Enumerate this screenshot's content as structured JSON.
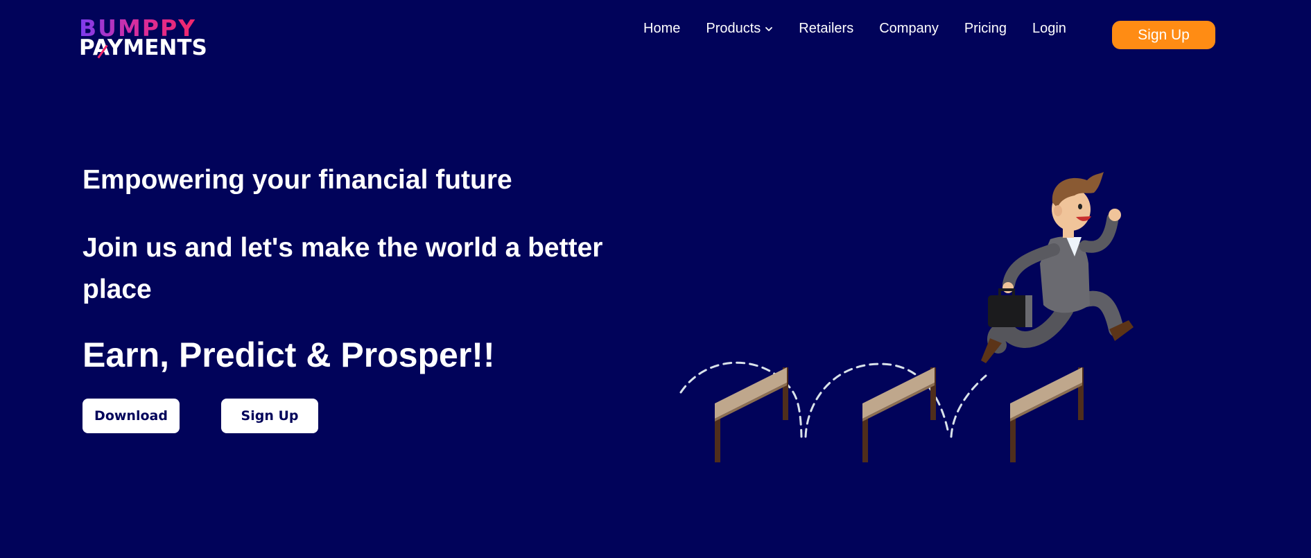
{
  "logo": {
    "top": "BUMPPY",
    "bottom": "PAYMENTS"
  },
  "nav": {
    "home": "Home",
    "products": "Products",
    "retailers": "Retailers",
    "company": "Company",
    "pricing": "Pricing",
    "login": "Login",
    "signup": "Sign Up"
  },
  "hero": {
    "line1": "Empowering your financial future",
    "line2a": "Join us and let's make the world a better",
    "line2b": "place",
    "line3": "Earn, Predict & Prosper!!",
    "download_label": "Download",
    "signup_label": "Sign Up"
  },
  "colors": {
    "background": "#01035a",
    "accent": "#ff8c14",
    "logo_gradient": [
      "#7b3cf0",
      "#f2276a"
    ]
  },
  "icons": {
    "products_dropdown": "chevron-down-icon"
  }
}
